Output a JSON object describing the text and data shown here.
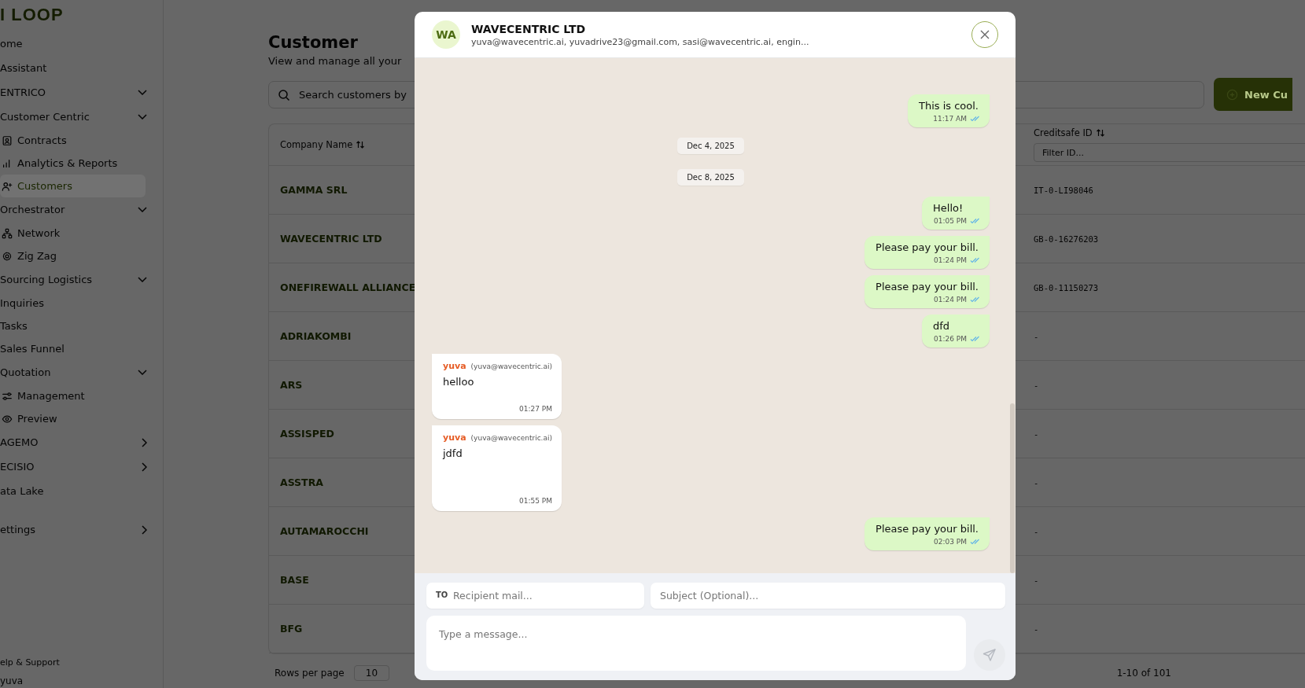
{
  "logo": "I LOOP",
  "sidebar": {
    "items": [
      {
        "label": "ome",
        "selected": false
      },
      {
        "label": "Assistant",
        "selected": false
      },
      {
        "label": "ENTRICO",
        "selected": false,
        "expanded": true,
        "children": [
          {
            "label": "Customer Centric",
            "selected": false,
            "expanded": true,
            "children": [
              {
                "label": "Contracts",
                "selected": false
              },
              {
                "label": "Analytics & Reports",
                "selected": false
              },
              {
                "label": "Customers",
                "selected": true
              }
            ]
          },
          {
            "label": "Orchestrator",
            "selected": false,
            "expanded": true,
            "children": [
              {
                "label": "Network",
                "selected": false
              },
              {
                "label": "Zig Zag",
                "selected": false
              }
            ]
          },
          {
            "label": "Sourcing Logistics",
            "selected": false,
            "expanded": true,
            "children": [
              {
                "label": "Inquiries",
                "selected": false
              },
              {
                "label": "Tasks",
                "selected": false
              },
              {
                "label": "Sales Funnel",
                "selected": false
              }
            ]
          },
          {
            "label": "Quotation",
            "selected": false,
            "expanded": true,
            "children": [
              {
                "label": "Management",
                "selected": false
              },
              {
                "label": "Preview",
                "selected": false
              }
            ]
          }
        ]
      },
      {
        "label": "AGEMO",
        "selected": false,
        "expanded": false
      },
      {
        "label": "ECISIO",
        "selected": false,
        "expanded": false
      },
      {
        "label": "ata Lake",
        "selected": false
      },
      {
        "label": "ettings",
        "selected": false,
        "expanded": false
      }
    ],
    "help": "elp & Support",
    "user": "yuva"
  },
  "page": {
    "title": "Customer",
    "subtitle": "View and manage all your",
    "search": {
      "placeholder": "Search customers by"
    },
    "new_button": "New Cu"
  },
  "table": {
    "columns": [
      {
        "label": "Company Name"
      },
      {
        "label": "Creditsafe ID",
        "filter_placeholder": "Filter ID..."
      }
    ],
    "rows": [
      [
        "GAMMA SRL",
        "IT-0-LI98046"
      ],
      [
        "WAVECENTRIC LTD",
        "GB-0-16276203"
      ],
      [
        "ONEFIREWALL ALLIANCE",
        "GB-0-11150273"
      ],
      [
        "ADRIAKOMBI",
        "-"
      ],
      [
        "ARS",
        "-"
      ],
      [
        "ASSISPED",
        "-"
      ],
      [
        "ASSTRA",
        "-"
      ],
      [
        "AUTAMAROCCHI",
        "-"
      ],
      [
        "BASE",
        "-"
      ],
      [
        "BFG",
        "-"
      ]
    ],
    "rows_per_page_label": "Rows per page",
    "rows_per_page": "10",
    "range": "1-10 of 101"
  },
  "chat": {
    "avatar": "WA",
    "title": "WAVECENTRIC LTD",
    "recipients": "yuva@wavecentric.ai, yuvadrive23@gmail.com, sasi@wavecentric.ai, engin...",
    "messages": [
      {
        "kind": "out",
        "text": "This is cool.",
        "time": "11:17 AM",
        "read": true
      },
      {
        "kind": "date",
        "text": "Dec 4, 2025"
      },
      {
        "kind": "date",
        "text": "Dec 8, 2025"
      },
      {
        "kind": "out",
        "text": "Hello!",
        "time": "01:05 PM",
        "read": true
      },
      {
        "kind": "out",
        "text": "Please pay your bill.",
        "time": "01:24 PM",
        "read": true
      },
      {
        "kind": "out",
        "text": "Please pay your bill.",
        "time": "01:24 PM",
        "read": true
      },
      {
        "kind": "out",
        "text": "dfd",
        "time": "01:26 PM",
        "read": true
      },
      {
        "kind": "in",
        "sender": "yuva",
        "email": "(yuva@wavecentric.ai)",
        "text": "helloo",
        "time": "01:27 PM"
      },
      {
        "kind": "in",
        "sender": "yuva",
        "email": "(yuva@wavecentric.ai)",
        "text": "jdfd",
        "time": "01:55 PM"
      },
      {
        "kind": "out",
        "text": "Please pay your bill.",
        "time": "02:03 PM",
        "read": true
      }
    ],
    "to_label": "TO",
    "to_placeholder": "Recipient mail...",
    "subject_placeholder": "Subject (Optional)...",
    "message_placeholder": "Type a message..."
  }
}
